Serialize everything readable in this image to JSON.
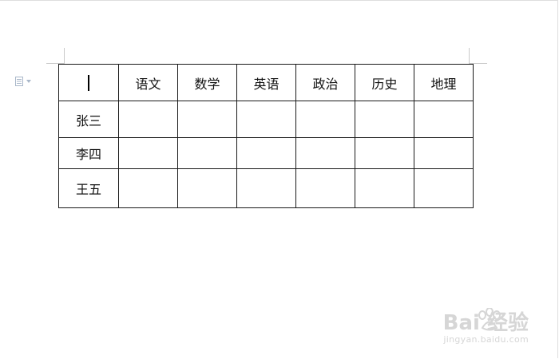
{
  "table": {
    "header": [
      "",
      "语文",
      "数学",
      "英语",
      "政治",
      "历史",
      "地理"
    ],
    "rows": [
      [
        "张三",
        "",
        "",
        "",
        "",
        "",
        ""
      ],
      [
        "李四",
        "",
        "",
        "",
        "",
        "",
        ""
      ],
      [
        "王五",
        "",
        "",
        "",
        "",
        "",
        ""
      ]
    ]
  },
  "watermark": {
    "logo_text": "Bai 经验",
    "url": "jingyan.baidu.com"
  },
  "icons": {
    "margin_widget": "paste-options-icon",
    "dropdown": "chevron-down-icon"
  },
  "colors": {
    "border": "#1a1a1a",
    "crop_mark": "#c9c9c9",
    "watermark": "#d6d6d6",
    "widget": "#a9b7c9"
  }
}
